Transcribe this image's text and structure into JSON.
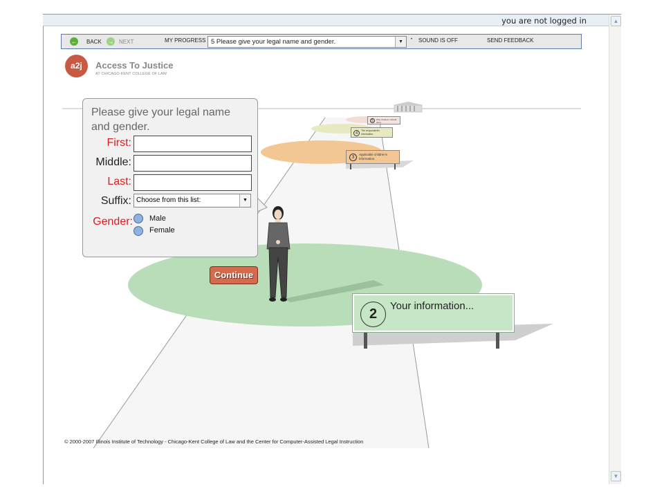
{
  "login_status": "you are not logged in",
  "nav": {
    "back_label": "BACK",
    "next_label": "NEXT",
    "progress_label": "MY PROGRESS",
    "progress_value": "5 Please give your legal name and gender.",
    "sound_label": "SOUND IS OFF",
    "feedback_label": "SEND FEEDBACK"
  },
  "brand": {
    "logo_text": "a2j",
    "name": "Access To Justice",
    "subtitle": "AT CHICAGO-KENT COLLEGE OF LAW"
  },
  "form": {
    "question": "Please give your legal name and gender.",
    "first_label": "First:",
    "middle_label": "Middle:",
    "last_label": "Last:",
    "suffix_label": "Suffix:",
    "suffix_value": "Choose from this list:",
    "gender_label": "Gender:",
    "gender_options": [
      "Male",
      "Female"
    ],
    "first_value": "",
    "middle_value": "",
    "last_value": ""
  },
  "continue_label": "Continue",
  "signs": {
    "current": {
      "number": "2",
      "text": "Your information..."
    },
    "step3": {
      "number": "3",
      "text": "Applicable children's information."
    },
    "step4": {
      "number": "4",
      "text": "The respondent's information."
    },
    "step5": {
      "number": "5",
      "text": "Why I believe I should have..."
    }
  },
  "footer": "© 2000-2007 Illinois Institute of Technology - Chicago-Kent College of Law and the Center for Computer-Assisted Legal Instruction",
  "colors": {
    "required_label": "#e0191b",
    "optional_label": "#222222",
    "path_green": "#b9ddb9",
    "path_orange": "#f2c794",
    "path_yellow": "#e7eac0",
    "continue_bg": "#d56b4e",
    "nav_border": "#5a7aa8"
  }
}
